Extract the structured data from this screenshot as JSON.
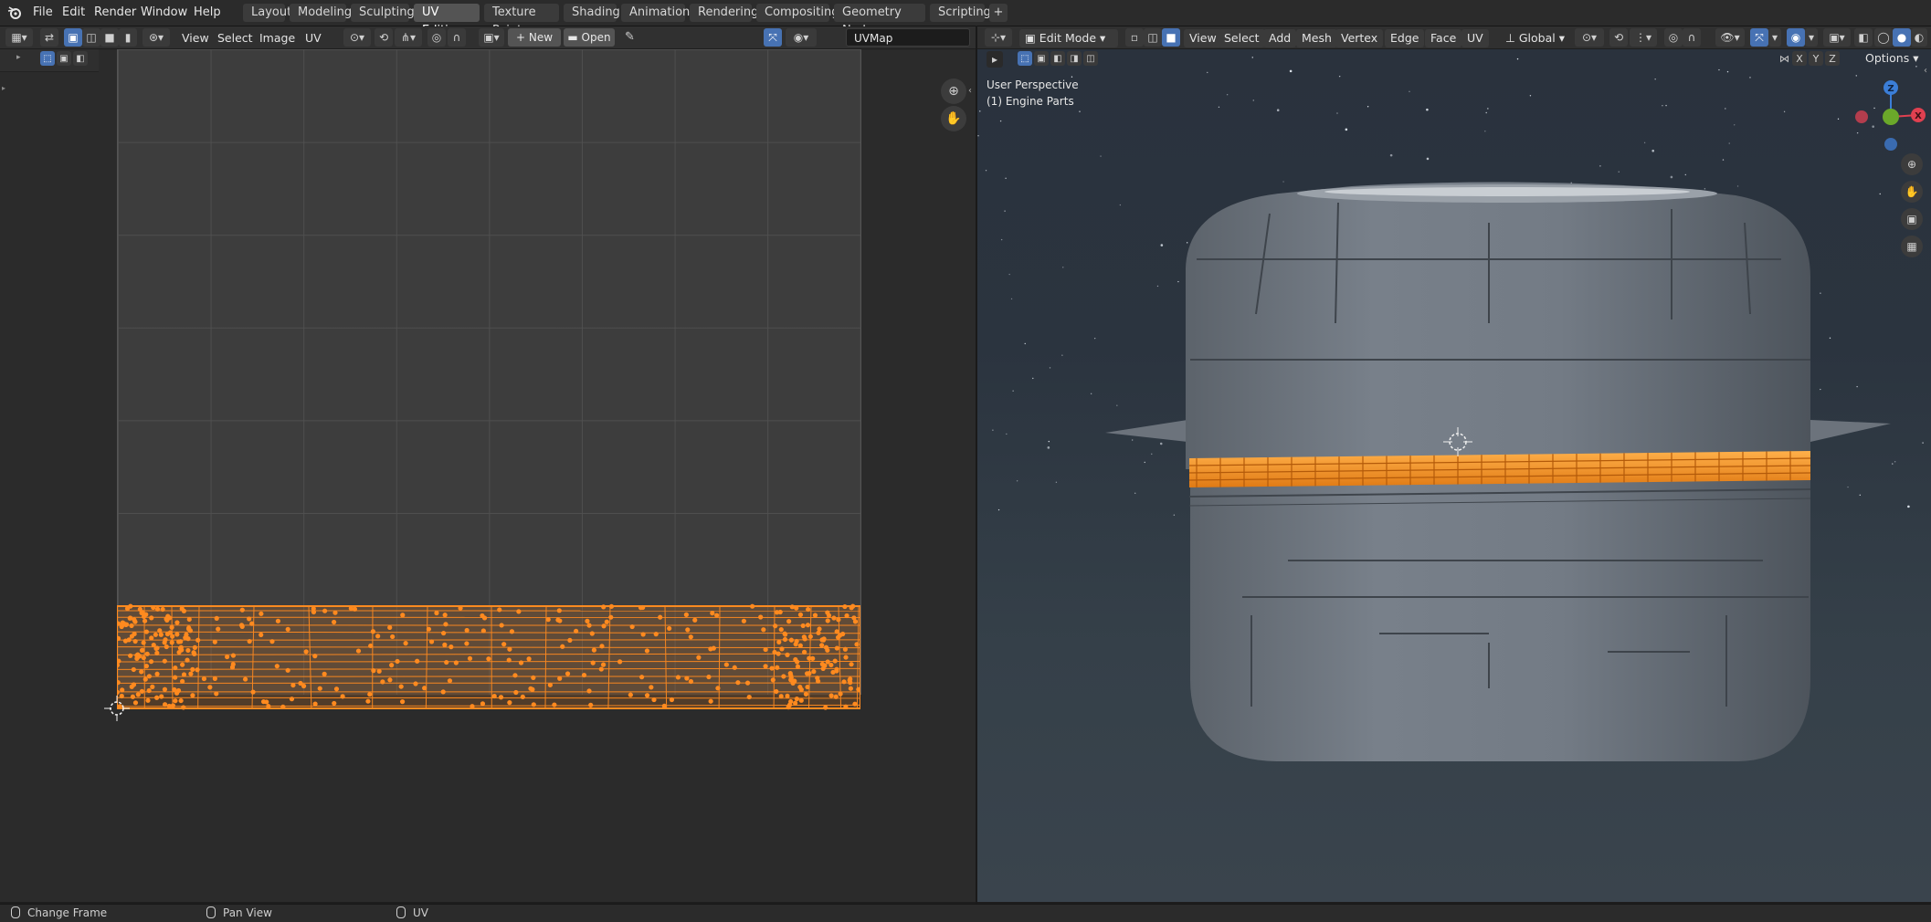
{
  "menus": [
    "File",
    "Edit",
    "Render",
    "Window",
    "Help"
  ],
  "workspaces": [
    "Layout",
    "Modeling",
    "Sculpting",
    "UV Editing",
    "Texture Paint",
    "Shading",
    "Animation",
    "Rendering",
    "Compositing",
    "Geometry Nodes",
    "Scripting"
  ],
  "active_workspace": "UV Editing",
  "add_workspace_label": "+",
  "uv_header": {
    "menus": [
      "View",
      "Select",
      "Image",
      "UV"
    ],
    "new_label": "New",
    "open_label": "Open",
    "uvmap_value": "UVMap"
  },
  "viewport_header": {
    "mode": "Edit Mode",
    "menus": [
      "View",
      "Select",
      "Add",
      "Mesh",
      "Vertex",
      "Edge",
      "Face",
      "UV"
    ],
    "orientation": "Global",
    "axes": [
      "X",
      "Y",
      "Z"
    ],
    "options_label": "Options"
  },
  "viewport_overlay": {
    "perspective": "User Perspective",
    "object": "(1) Engine Parts"
  },
  "gizmo": {
    "z": "Z",
    "x": "X"
  },
  "statusbar": {
    "left": "Change Frame",
    "middle": "Pan View",
    "right": "UV"
  },
  "colors": {
    "accent": "#4772b3",
    "selection": "#ff8a1f",
    "axis_x": "#e04050",
    "axis_y": "#6ba82a",
    "axis_z": "#3b7ed8"
  }
}
